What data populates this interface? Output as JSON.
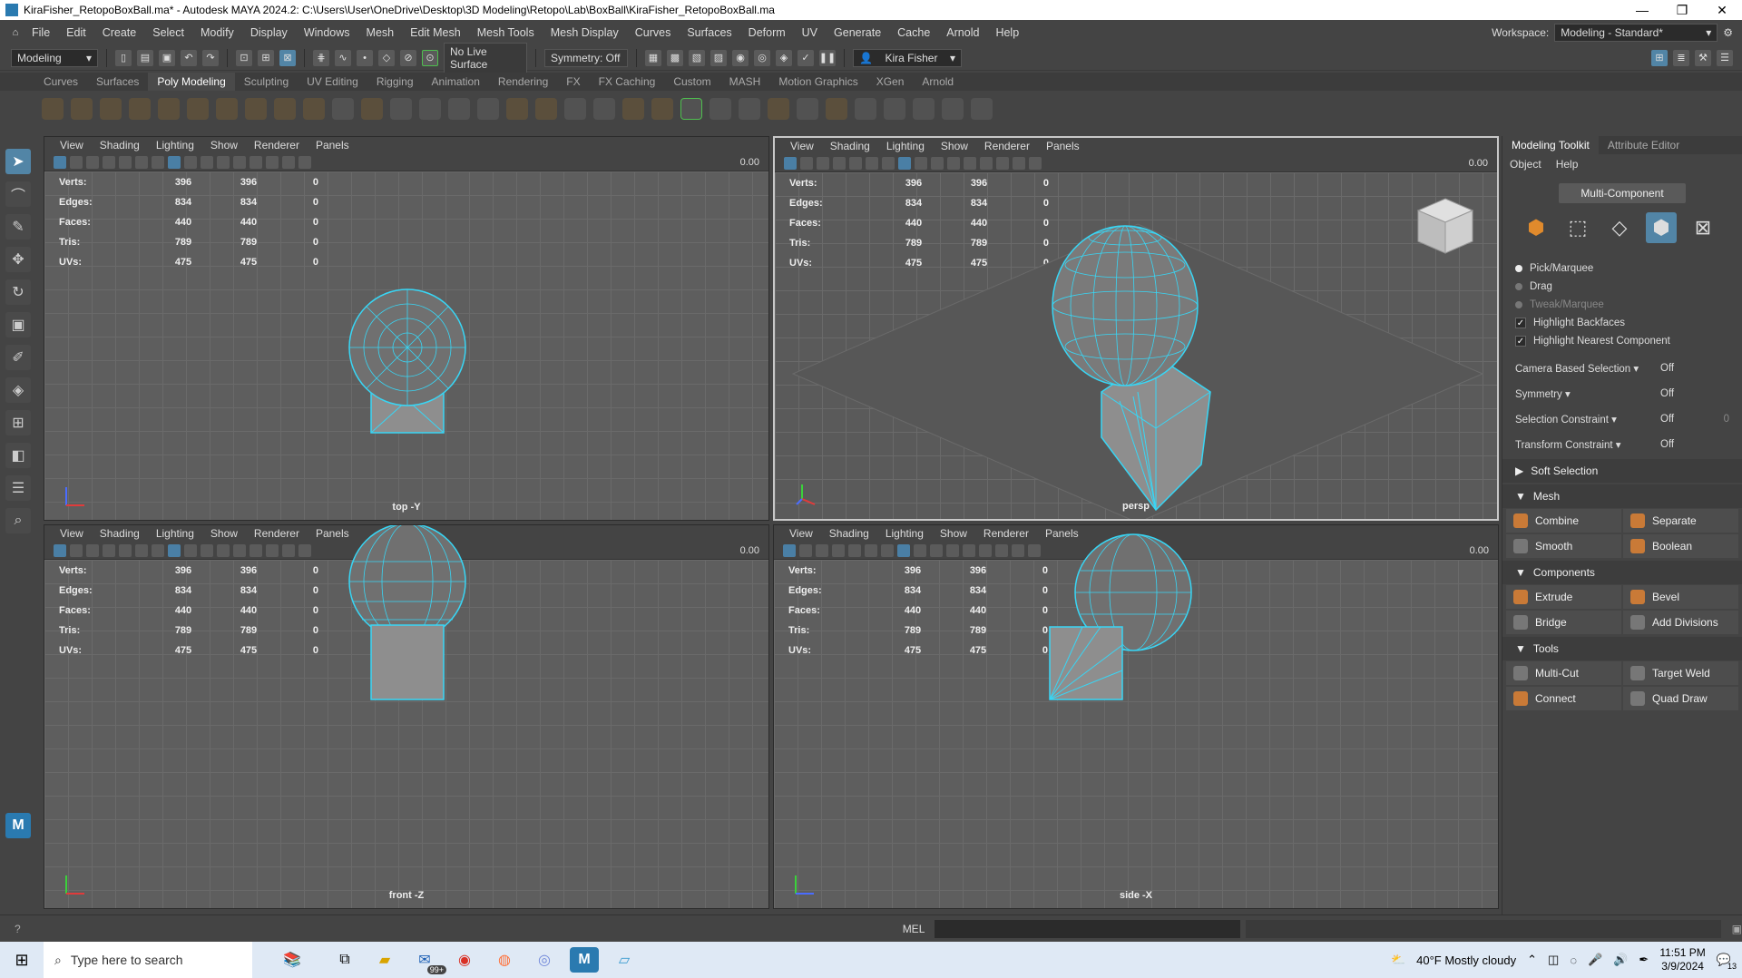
{
  "window": {
    "title": "KiraFisher_RetopoBoxBall.ma* - Autodesk MAYA 2024.2: C:\\Users\\User\\OneDrive\\Desktop\\3D Modeling\\Retopo\\Lab\\BoxBall\\KiraFisher_RetopoBoxBall.ma"
  },
  "menubar": {
    "items": [
      "File",
      "Edit",
      "Create",
      "Select",
      "Modify",
      "Display",
      "Windows",
      "Mesh",
      "Edit Mesh",
      "Mesh Tools",
      "Mesh Display",
      "Curves",
      "Surfaces",
      "Deform",
      "UV",
      "Generate",
      "Cache",
      "Arnold",
      "Help"
    ],
    "workspace_label": "Workspace:",
    "workspace_value": "Modeling - Standard*"
  },
  "statusline": {
    "mode": "Modeling",
    "live_surface": "No Live Surface",
    "symmetry": "Symmetry: Off",
    "user": "Kira Fisher"
  },
  "shelf": {
    "tabs": [
      "Curves",
      "Surfaces",
      "Poly Modeling",
      "Sculpting",
      "UV Editing",
      "Rigging",
      "Animation",
      "Rendering",
      "FX",
      "FX Caching",
      "Custom",
      "MASH",
      "Motion Graphics",
      "XGen",
      "Arnold"
    ],
    "active": "Poly Modeling"
  },
  "viewport_menu": [
    "View",
    "Shading",
    "Lighting",
    "Show",
    "Renderer",
    "Panels"
  ],
  "viewport_value": "0.00",
  "hud": [
    {
      "label": "Verts:",
      "a": "396",
      "b": "396",
      "c": "0"
    },
    {
      "label": "Edges:",
      "a": "834",
      "b": "834",
      "c": "0"
    },
    {
      "label": "Faces:",
      "a": "440",
      "b": "440",
      "c": "0"
    },
    {
      "label": "Tris:",
      "a": "789",
      "b": "789",
      "c": "0"
    },
    {
      "label": "UVs:",
      "a": "475",
      "b": "475",
      "c": "0"
    }
  ],
  "viewports": {
    "top": "top -Y",
    "persp": "persp",
    "front": "front -Z",
    "side": "side -X"
  },
  "toolkit": {
    "tabs": [
      "Modeling Toolkit",
      "Attribute Editor"
    ],
    "menu": [
      "Object",
      "Help"
    ],
    "multi_component": "Multi-Component",
    "pick_marquee": "Pick/Marquee",
    "drag": "Drag",
    "tweak_marquee": "Tweak/Marquee",
    "highlight_backfaces": "Highlight Backfaces",
    "highlight_nearest": "Highlight Nearest Component",
    "camera_based": "Camera Based Selection",
    "camera_based_val": "Off",
    "symmetry": "Symmetry",
    "symmetry_val": "Off",
    "selection_constraint": "Selection Constraint",
    "selection_constraint_val": "Off",
    "selection_constraint_num": "0",
    "transform_constraint": "Transform Constraint",
    "transform_constraint_val": "Off",
    "soft_selection": "Soft Selection",
    "mesh": "Mesh",
    "combine": "Combine",
    "separate": "Separate",
    "smooth": "Smooth",
    "boolean": "Boolean",
    "components": "Components",
    "extrude": "Extrude",
    "bevel": "Bevel",
    "bridge": "Bridge",
    "add_divisions": "Add Divisions",
    "tools": "Tools",
    "multi_cut": "Multi-Cut",
    "target_weld": "Target Weld",
    "connect": "Connect",
    "quad_draw": "Quad Draw"
  },
  "cmdline": {
    "lang": "MEL"
  },
  "taskbar": {
    "search_placeholder": "Type here to search",
    "mail_badge": "99+",
    "weather": "40°F  Mostly cloudy",
    "time": "11:51 PM",
    "date": "3/9/2024",
    "notif": "13"
  },
  "colors": {
    "wire": "#38d6f5",
    "active_blue": "#5285a6",
    "mesh_gray": "#8e8e8e"
  }
}
